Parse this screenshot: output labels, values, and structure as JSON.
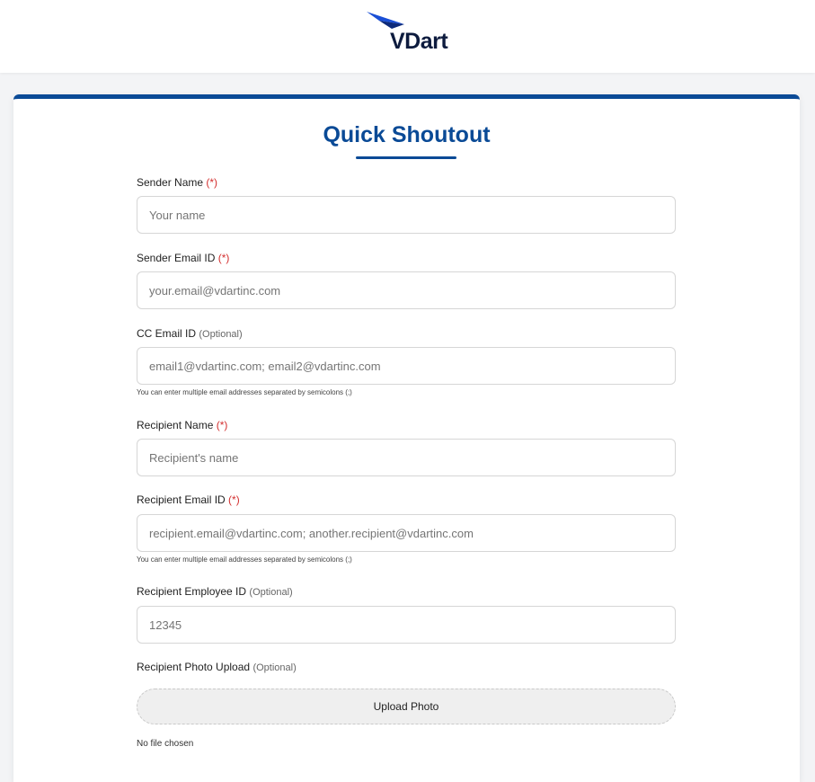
{
  "header": {
    "logo_text": "VDart"
  },
  "form": {
    "title": "Quick Shoutout",
    "fields": {
      "sender_name": {
        "label": "Sender Name",
        "marker": "(*)",
        "placeholder": "Your name",
        "value": ""
      },
      "sender_email": {
        "label": "Sender Email ID",
        "marker": "(*)",
        "placeholder": "your.email@vdartinc.com",
        "value": ""
      },
      "cc_email": {
        "label": "CC Email ID",
        "marker": "(Optional)",
        "placeholder": "email1@vdartinc.com; email2@vdartinc.com",
        "value": "",
        "hint": "You can enter multiple email addresses separated by semicolons (;)"
      },
      "recipient_name": {
        "label": "Recipient Name",
        "marker": "(*)",
        "placeholder": "Recipient's name",
        "value": ""
      },
      "recipient_email": {
        "label": "Recipient Email ID",
        "marker": "(*)",
        "placeholder": "recipient.email@vdartinc.com; another.recipient@vdartinc.com",
        "value": "",
        "hint": "You can enter multiple email addresses separated by semicolons (;)"
      },
      "recipient_employee_id": {
        "label": "Recipient Employee ID",
        "marker": "(Optional)",
        "placeholder": "12345",
        "value": ""
      },
      "recipient_photo": {
        "label": "Recipient Photo Upload",
        "marker": "(Optional)",
        "button_label": "Upload Photo",
        "file_status": "No file chosen"
      }
    }
  },
  "colors": {
    "brand_blue": "#0a4a96",
    "required_red": "#d32f2f",
    "logo_text": "#0d1b3e"
  }
}
